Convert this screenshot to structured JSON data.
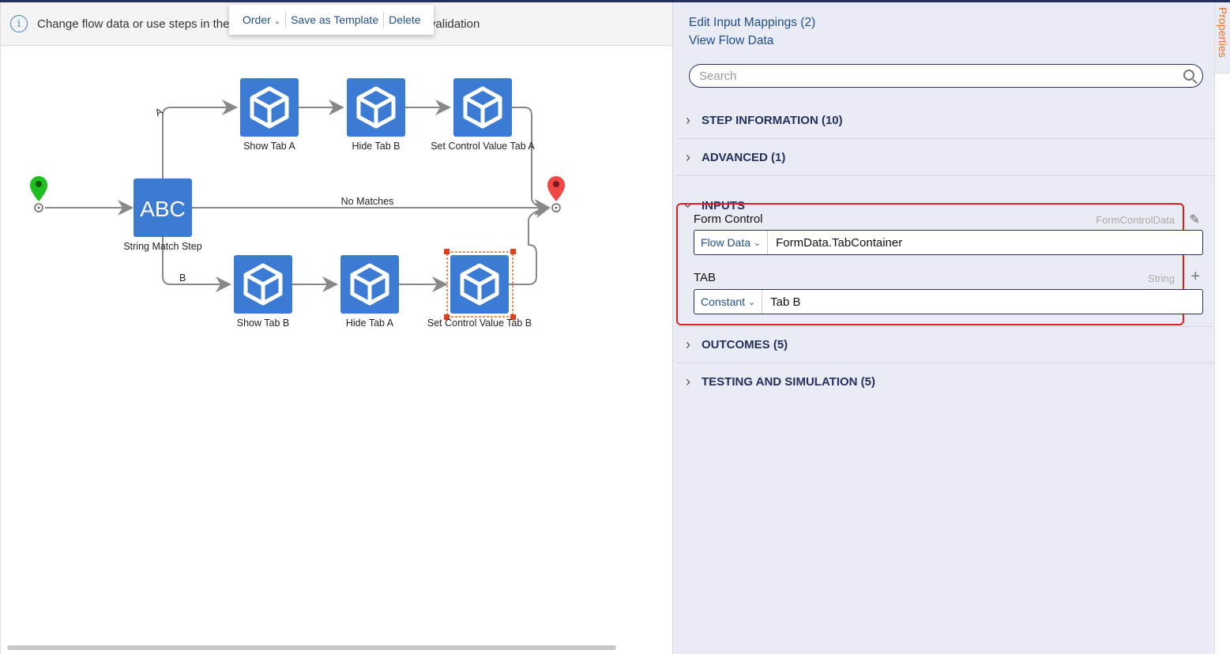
{
  "info_bar": {
    "text": "Change flow data or use steps in the form to change form data, visibility or validation"
  },
  "context_menu": {
    "order": "Order",
    "save_template": "Save as Template",
    "delete": "Delete"
  },
  "flow": {
    "start_step": "String Match Step",
    "start_icon_text": "ABC",
    "branch_a": "A",
    "branch_b": "B",
    "no_matches": "No  Matches",
    "top_steps": [
      "Show Tab A",
      "Hide Tab B",
      "Set Control Value Tab A"
    ],
    "bottom_steps": [
      "Show Tab B",
      "Hide Tab A",
      "Set Control Value Tab B"
    ],
    "selected_step": "Set Control Value Tab B"
  },
  "panel": {
    "links": [
      "Edit Input Mappings (2)",
      "View Flow Data"
    ],
    "search_placeholder": "Search",
    "sections": {
      "step_info": "STEP INFORMATION (10)",
      "advanced": "ADVANCED (1)",
      "inputs": "INPUTS",
      "outcomes": "OUTCOMES (5)",
      "testing": "TESTING AND SIMULATION (5)"
    },
    "inputs": [
      {
        "label": "Form Control",
        "type": "FormControlData",
        "source": "Flow Data",
        "value": "FormData.TabContainer"
      },
      {
        "label": "TAB",
        "type": "String",
        "source": "Constant",
        "value": "Tab B"
      }
    ]
  },
  "side_tab": "Properties",
  "colors": {
    "accent": "#1f4e8c",
    "node": "#3b7bd4",
    "highlight": "#e02020",
    "tab": "#f07020"
  }
}
